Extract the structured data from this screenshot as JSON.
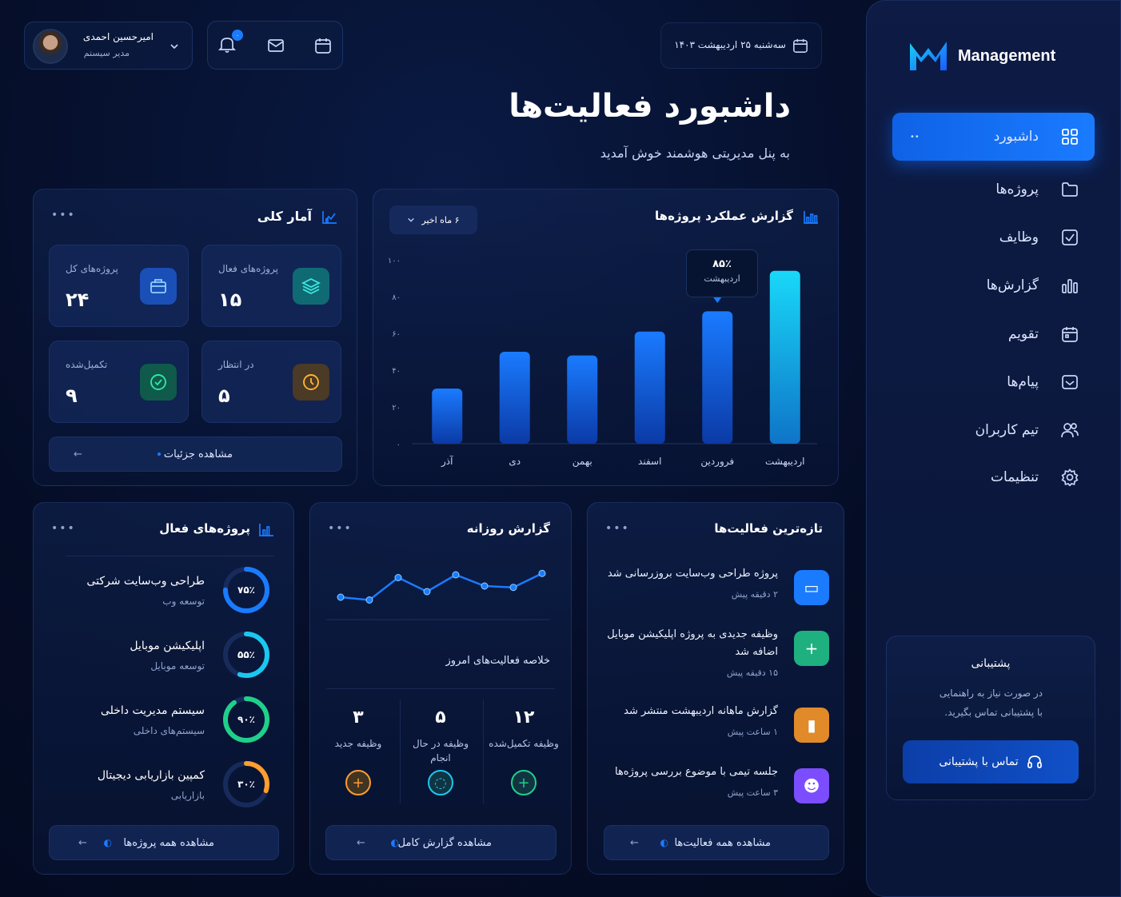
{
  "user": {
    "name": "امیرحسین احمدی",
    "role": "مدیر سیستم"
  },
  "header": {
    "date": "سه‌شنبه ۲۵ اردیبهشت ۱۴۰۳",
    "notif_count": "۰"
  },
  "page": {
    "title": "داشبورد فعالیت‌ها",
    "subtitle": "به پنل مدیریتی هوشمند خوش آمدید"
  },
  "brand": {
    "name": "Management"
  },
  "sidebar": {
    "items": [
      {
        "label": "داشبورد",
        "icon": "grid-icon"
      },
      {
        "label": "پروژه‌ها",
        "icon": "folder-icon"
      },
      {
        "label": "وظایف",
        "icon": "checkbox-icon"
      },
      {
        "label": "گزارش‌ها",
        "icon": "bar-chart-icon"
      },
      {
        "label": "تقویم",
        "icon": "calendar-icon"
      },
      {
        "label": "پیام‌ها",
        "icon": "inbox-icon"
      },
      {
        "label": "تیم کاربران",
        "icon": "users-icon"
      },
      {
        "label": "تنظیمات",
        "icon": "gear-icon"
      }
    ],
    "active_dots": "••"
  },
  "support": {
    "title": "پشتیبانی",
    "line1": "در صورت نیاز به راهنمایی",
    "line2": "با پشتیبانی تماس بگیرید.",
    "button": "تماس با پشتیبانی"
  },
  "overview": {
    "title": "آمار کلی",
    "stats": [
      {
        "label": "پروژه‌های فعال",
        "value": "۱۵"
      },
      {
        "label": "پروژه‌های کل",
        "value": "۲۴"
      },
      {
        "label": "در انتظار",
        "value": "۵"
      },
      {
        "label": "تکمیل‌شده",
        "value": "۹"
      }
    ],
    "details_button": "مشاهده جزئیات"
  },
  "report": {
    "title": "گزارش عملکرد پروژه‌ها",
    "range": "۶ ماه اخیر",
    "tooltip_value": "۸۵٪",
    "tooltip_label": "اردیبهشت"
  },
  "chart_data": {
    "type": "bar",
    "title": "گزارش عملکرد پروژه‌ها",
    "categories": [
      "آذر",
      "دی",
      "بهمن",
      "اسفند",
      "فروردین",
      "اردیبهشت"
    ],
    "values": [
      30,
      50,
      48,
      61,
      72,
      94
    ],
    "ylim": [
      0,
      100
    ],
    "yticks": [
      "۰",
      "۲۰",
      "۴۰",
      "۶۰",
      "۸۰",
      "۱۰۰"
    ],
    "colors": {
      "low": "#0a3aa8",
      "high": "#1a7bff",
      "highlight": "#19d2f5"
    }
  },
  "active_projects": {
    "title": "پروژه‌های فعال",
    "items": [
      {
        "name": "طراحی وب‌سایت شرکتی",
        "category": "توسعه وب",
        "percent": 75,
        "percent_label": "۷۵٪",
        "color": "#1a7bff"
      },
      {
        "name": "اپلیکیشن موبایل",
        "category": "توسعه موبایل",
        "percent": 55,
        "percent_label": "۵۵٪",
        "color": "#19c8f0"
      },
      {
        "name": "سیستم مدیریت داخلی",
        "category": "سیستم‌های داخلی",
        "percent": 90,
        "percent_label": "۹۰٪",
        "color": "#1fd08a"
      },
      {
        "name": "کمپین بازاریابی دیجیتال",
        "category": "بازاریابی",
        "percent": 30,
        "percent_label": "۳۰٪",
        "color": "#ff9d2e"
      }
    ],
    "button": "مشاهده همه پروژه‌ها"
  },
  "daily": {
    "title": "گزارش روزانه",
    "summary_title": "خلاصه فعالیت‌های امروز",
    "line": [
      36,
      34,
      50,
      40,
      52,
      44,
      43,
      53
    ],
    "summary": [
      {
        "value": "۱۲",
        "label": "وظیفه تکمیل‌شده",
        "color": "#1fd08a",
        "icon": "plus-icon"
      },
      {
        "value": "۵",
        "label": "وظیفه در حال انجام",
        "color": "#19c8f0",
        "icon": "spinner-icon"
      },
      {
        "value": "۳",
        "label": "وظیفه جدید",
        "color": "#ff9d2e",
        "icon": "plus-icon"
      }
    ],
    "button": "مشاهده گزارش کامل"
  },
  "activities": {
    "title": "تازه‌ترین فعالیت‌ها",
    "items": [
      {
        "text": "پروژه طراحی وب‌سایت بروزرسانی شد",
        "time": "۲ دقیقه پیش",
        "color": "#1a7bff"
      },
      {
        "text": "وظیفه جدیدی به پروژه اپلیکیشن موبایل اضافه شد",
        "time": "۱۵ دقیقه پیش",
        "color": "#1fb080"
      },
      {
        "text": "گزارش ماهانه اردیبهشت منتشر شد",
        "time": "۱ ساعت پیش",
        "color": "#e08a2a"
      },
      {
        "text": "جلسه تیمی با موضوع بررسی پروژه‌ها",
        "time": "۳ ساعت پیش",
        "color": "#7b4dff"
      }
    ],
    "button": "مشاهده همه فعالیت‌ها"
  }
}
